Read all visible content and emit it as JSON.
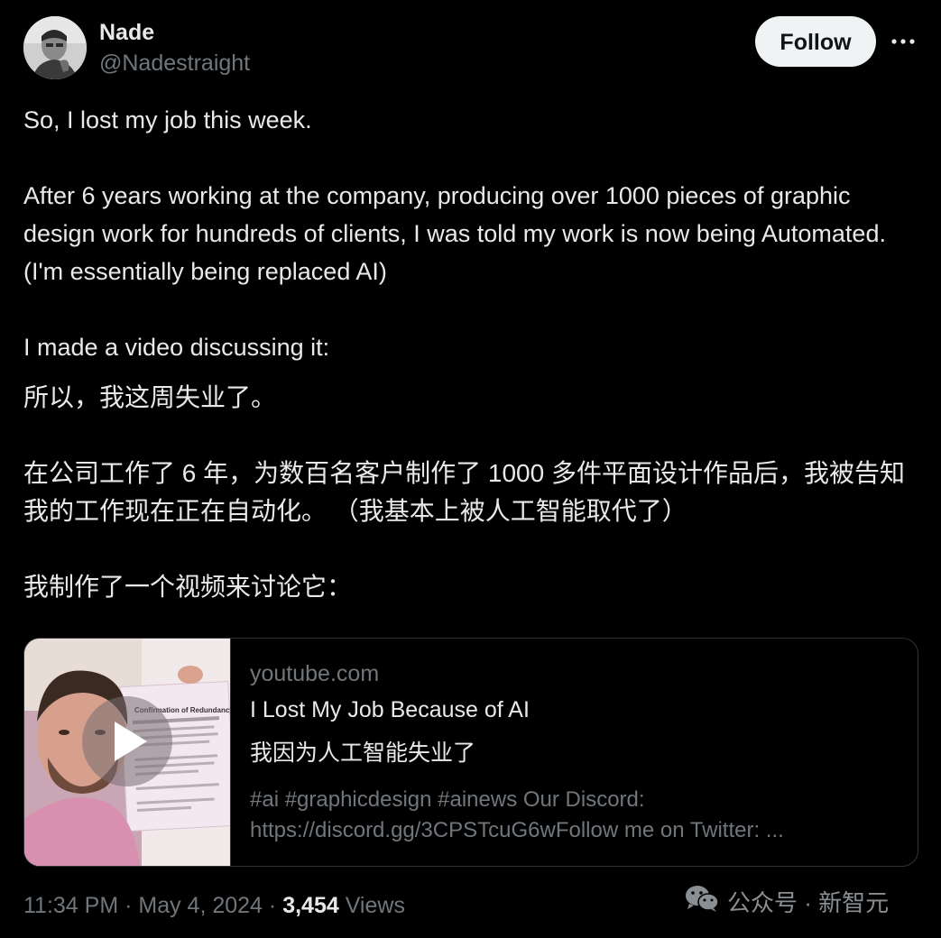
{
  "author": {
    "display_name": "Nade",
    "handle": "@Nadestraight"
  },
  "follow_button": {
    "label": "Follow"
  },
  "more_menu": {
    "icon": "more-horizontal-icon"
  },
  "tweet": {
    "lines": [
      "So, I lost my job this week.",
      "After 6 years working at the company, producing over 1000 pieces of graphic design work for hundreds of clients, I was told my work is now being Automated. (I'm essentially being replaced AI)",
      "I made a video discussing it:"
    ],
    "translation": [
      "所以，我这周失业了。",
      "在公司工作了 6 年，为数百名客户制作了 1000 多件平面设计作品后，我被告知我的工作现在正在自动化。 （我基本上被人工智能取代了）",
      "我制作了一个视频来讨论它："
    ]
  },
  "link_card": {
    "domain": "youtube.com",
    "title": "I Lost My Job Because of AI",
    "title_translation": "我因为人工智能失业了",
    "description": "#ai #graphicdesign #ainews Our Discord:",
    "description_line2": "https://discord.gg/3CPSTcuG6wFollow me on Twitter: ...",
    "thumbnail": {
      "paper_heading": "Confirmation of Redundancy",
      "play_icon": "play-icon"
    }
  },
  "footer": {
    "time": "11:34 PM",
    "separator": " · ",
    "date": "May 4, 2024",
    "views_count": "3,454",
    "views_label": "Views"
  },
  "watermark": {
    "text": "公众号 · 新智元",
    "icon": "wechat-icon"
  },
  "colors": {
    "background": "#000000",
    "text_primary": "#e7e9ea",
    "text_secondary": "#71767b",
    "border": "#2f3336",
    "follow_bg": "#eff3f4"
  }
}
